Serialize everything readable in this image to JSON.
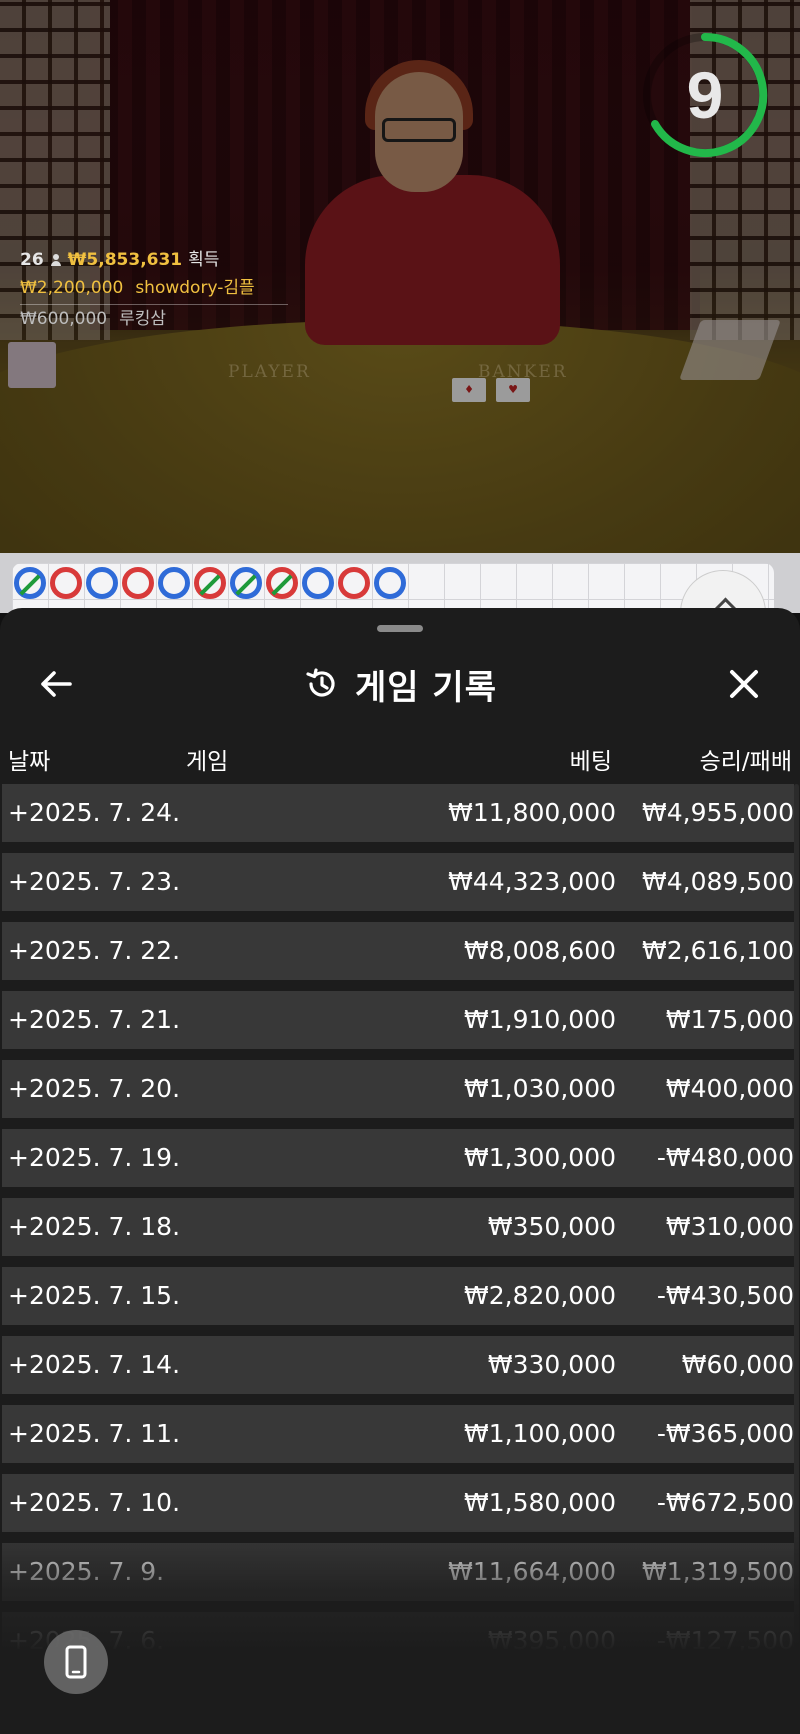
{
  "video": {
    "timer_value": "9",
    "table_left_label": "PLAYER",
    "table_right_label": "BANKER",
    "win_summary": {
      "count": "26",
      "total": "₩5,853,631",
      "suffix": "획득"
    },
    "winners": [
      {
        "amount": "₩2,200,000",
        "name": "showdory-김플"
      },
      {
        "amount": "₩600,000",
        "name": "루킹삼"
      }
    ]
  },
  "roadmap": {
    "beads": [
      "b-tie",
      "r",
      "b",
      "r",
      "b",
      "r-tie",
      "b-tie",
      "r-tie",
      "b",
      "r",
      "b"
    ]
  },
  "sheet": {
    "title": "게임 기록",
    "icons": {
      "back": "arrow-left-icon",
      "history": "history-icon",
      "close": "close-icon",
      "phone": "phone-icon"
    },
    "columns": {
      "date": "날짜",
      "game": "게임",
      "bet": "베팅",
      "win_loss": "승리/패배"
    },
    "rows": [
      {
        "date": "+2025. 7. 24.",
        "bet": "₩11,800,000",
        "win_loss": "₩4,955,000"
      },
      {
        "date": "+2025. 7. 23.",
        "bet": "₩44,323,000",
        "win_loss": "₩4,089,500"
      },
      {
        "date": "+2025. 7. 22.",
        "bet": "₩8,008,600",
        "win_loss": "₩2,616,100"
      },
      {
        "date": "+2025. 7. 21.",
        "bet": "₩1,910,000",
        "win_loss": "₩175,000"
      },
      {
        "date": "+2025. 7. 20.",
        "bet": "₩1,030,000",
        "win_loss": "₩400,000"
      },
      {
        "date": "+2025. 7. 19.",
        "bet": "₩1,300,000",
        "win_loss": "-₩480,000"
      },
      {
        "date": "+2025. 7. 18.",
        "bet": "₩350,000",
        "win_loss": "₩310,000"
      },
      {
        "date": "+2025. 7. 15.",
        "bet": "₩2,820,000",
        "win_loss": "-₩430,500"
      },
      {
        "date": "+2025. 7. 14.",
        "bet": "₩330,000",
        "win_loss": "₩60,000"
      },
      {
        "date": "+2025. 7. 11.",
        "bet": "₩1,100,000",
        "win_loss": "-₩365,000"
      },
      {
        "date": "+2025. 7. 10.",
        "bet": "₩1,580,000",
        "win_loss": "-₩672,500"
      },
      {
        "date": "+2025. 7. 9.",
        "bet": "₩11,664,000",
        "win_loss": "₩1,319,500"
      },
      {
        "date": "+2025. 7. 6.",
        "bet": "₩395,000",
        "win_loss": "-₩127,500"
      }
    ]
  },
  "colors": {
    "gold": "#f0c040",
    "timer_green": "#22b84a",
    "sheet_bg": "#1c1c1c",
    "row_bg": "#383838",
    "player_blue": "#2f6bd8",
    "banker_red": "#d83a3a",
    "tie_green": "#1e9a3a"
  }
}
